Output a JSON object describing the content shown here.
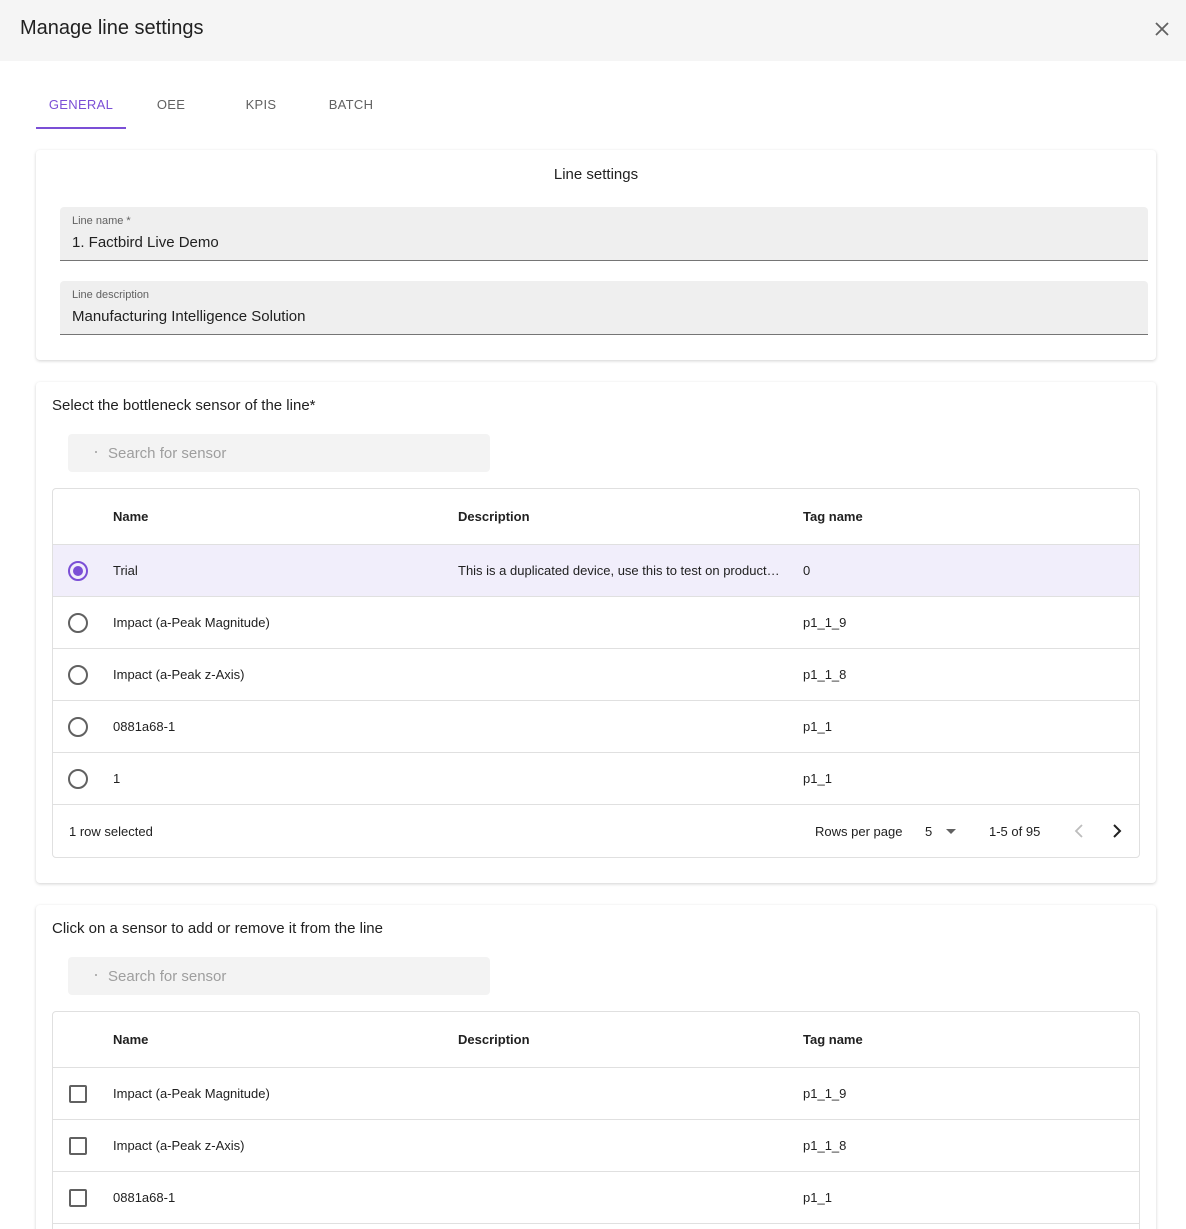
{
  "dialog": {
    "title": "Manage line settings"
  },
  "tabs": [
    {
      "label": "GENERAL",
      "active": true
    },
    {
      "label": "OEE",
      "active": false
    },
    {
      "label": "KPIS",
      "active": false
    },
    {
      "label": "BATCH",
      "active": false
    }
  ],
  "line_settings": {
    "title": "Line settings",
    "line_name_label": "Line name *",
    "line_name_value": "1. Factbird Live Demo",
    "line_description_label": "Line description",
    "line_description_value": "Manufacturing Intelligence Solution"
  },
  "bottleneck": {
    "title": "Select the bottleneck sensor of the line*",
    "search_placeholder": "Search for sensor",
    "columns": {
      "name": "Name",
      "description": "Description",
      "tag": "Tag name"
    },
    "rows": [
      {
        "name": "Trial",
        "description": "This is a duplicated device, use this to test on productivity",
        "tag": "0",
        "selected": true
      },
      {
        "name": "Impact (a-Peak Magnitude)",
        "description": "",
        "tag": "p1_1_9",
        "selected": false
      },
      {
        "name": "Impact (a-Peak z-Axis)",
        "description": "",
        "tag": "p1_1_8",
        "selected": false
      },
      {
        "name": "0881a68-1",
        "description": "",
        "tag": "p1_1",
        "selected": false
      },
      {
        "name": "1",
        "description": "",
        "tag": "p1_1",
        "selected": false
      }
    ],
    "footer": {
      "selected_text": "1 row selected",
      "rows_per_page_label": "Rows per page",
      "rows_per_page_value": "5",
      "range": "1-5 of 95"
    }
  },
  "line_sensors": {
    "title": "Click on a sensor to add or remove it from the line",
    "search_placeholder": "Search for sensor",
    "columns": {
      "name": "Name",
      "description": "Description",
      "tag": "Tag name"
    },
    "rows": [
      {
        "name": "Impact (a-Peak Magnitude)",
        "description": "",
        "tag": "p1_1_9",
        "checked": false
      },
      {
        "name": "Impact (a-Peak z-Axis)",
        "description": "",
        "tag": "p1_1_8",
        "checked": false
      },
      {
        "name": "0881a68-1",
        "description": "",
        "tag": "p1_1",
        "checked": false
      }
    ]
  },
  "colors": {
    "accent": "#7b4fd6",
    "selected_row_bg": "#f1eefb",
    "header_bg": "#f5f5f5"
  }
}
